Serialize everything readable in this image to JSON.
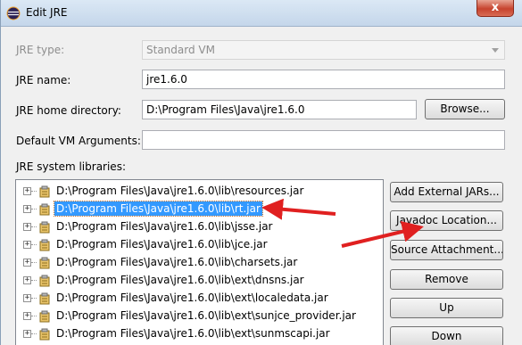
{
  "window": {
    "title": "Edit JRE",
    "close_glyph": "x"
  },
  "form": {
    "jre_type": {
      "label": "JRE type:",
      "value": "Standard VM"
    },
    "jre_name": {
      "label": "JRE name:",
      "value": "jre1.6.0"
    },
    "jre_home": {
      "label": "JRE home directory:",
      "value": "D:\\Program Files\\Java\\jre1.6.0",
      "browse_label": "Browse..."
    },
    "vm_args": {
      "label": "Default VM Arguments:",
      "value": ""
    },
    "libraries_label": "JRE system libraries:"
  },
  "libraries": [
    {
      "path": "D:\\Program Files\\Java\\jre1.6.0\\lib\\resources.jar",
      "selected": false
    },
    {
      "path": "D:\\Program Files\\Java\\jre1.6.0\\lib\\rt.jar",
      "selected": true
    },
    {
      "path": "D:\\Program Files\\Java\\jre1.6.0\\lib\\jsse.jar",
      "selected": false
    },
    {
      "path": "D:\\Program Files\\Java\\jre1.6.0\\lib\\jce.jar",
      "selected": false
    },
    {
      "path": "D:\\Program Files\\Java\\jre1.6.0\\lib\\charsets.jar",
      "selected": false
    },
    {
      "path": "D:\\Program Files\\Java\\jre1.6.0\\lib\\ext\\dnsns.jar",
      "selected": false
    },
    {
      "path": "D:\\Program Files\\Java\\jre1.6.0\\lib\\ext\\localedata.jar",
      "selected": false
    },
    {
      "path": "D:\\Program Files\\Java\\jre1.6.0\\lib\\ext\\sunjce_provider.jar",
      "selected": false
    },
    {
      "path": "D:\\Program Files\\Java\\jre1.6.0\\lib\\ext\\sunmscapi.jar",
      "selected": false
    }
  ],
  "expander_glyph": "+",
  "side_buttons": {
    "add_external": "Add External JARs...",
    "javadoc": "Javadoc Location...",
    "source": "Source Attachment...",
    "remove": "Remove",
    "up": "Up",
    "down": "Down"
  },
  "colors": {
    "selection": "#3399ff",
    "annotation_arrow": "#e02020",
    "close_button": "#c7432e"
  },
  "icons": {
    "window": "eclipse-icon",
    "library": "jar-library-icon",
    "annotation": "red-arrow"
  }
}
